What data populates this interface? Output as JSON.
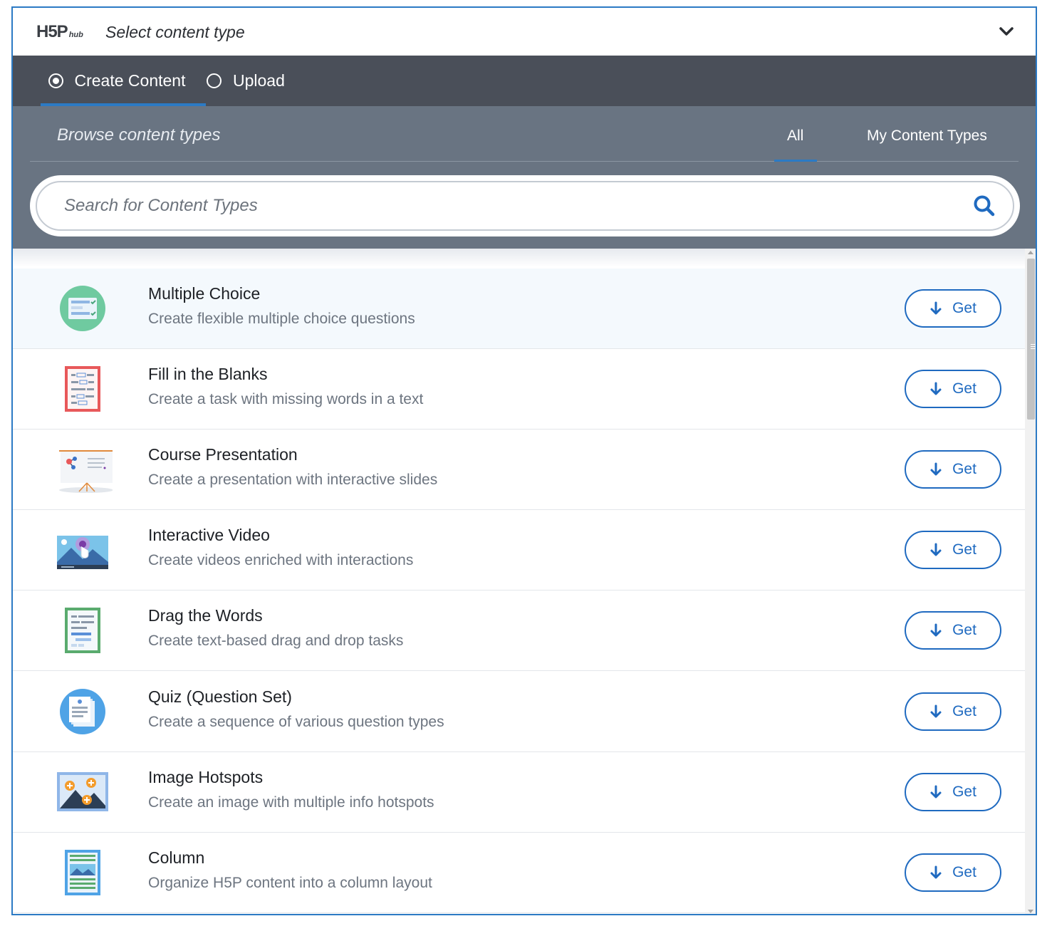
{
  "header": {
    "logo_main": "H5P",
    "logo_sub": "hub",
    "title": "Select content type"
  },
  "tabs": [
    {
      "label": "Create Content",
      "selected": true
    },
    {
      "label": "Upload",
      "selected": false
    }
  ],
  "browse": {
    "title": "Browse content types",
    "filters": [
      {
        "label": "All",
        "active": true
      },
      {
        "label": "My Content Types",
        "active": false
      }
    ]
  },
  "search": {
    "placeholder": "Search for Content Types",
    "value": ""
  },
  "items": [
    {
      "title": "Multiple Choice",
      "description": "Create flexible multiple choice questions",
      "icon": "multiple-choice-icon",
      "button": "Get"
    },
    {
      "title": "Fill in the Blanks",
      "description": "Create a task with missing words in a text",
      "icon": "fill-in-the-blanks-icon",
      "button": "Get"
    },
    {
      "title": "Course Presentation",
      "description": "Create a presentation with interactive slides",
      "icon": "course-presentation-icon",
      "button": "Get"
    },
    {
      "title": "Interactive Video",
      "description": "Create videos enriched with interactions",
      "icon": "interactive-video-icon",
      "button": "Get"
    },
    {
      "title": "Drag the Words",
      "description": "Create text-based drag and drop tasks",
      "icon": "drag-the-words-icon",
      "button": "Get"
    },
    {
      "title": "Quiz (Question Set)",
      "description": "Create a sequence of various question types",
      "icon": "quiz-question-set-icon",
      "button": "Get"
    },
    {
      "title": "Image Hotspots",
      "description": "Create an image with multiple info hotspots",
      "icon": "image-hotspots-icon",
      "button": "Get"
    },
    {
      "title": "Column",
      "description": "Organize H5P content into a column layout",
      "icon": "column-icon",
      "button": "Get"
    }
  ],
  "colors": {
    "accent": "#1f6ac0",
    "tabbar_bg": "#4a4f59",
    "browse_bg": "#697482",
    "frame_border": "#2c7ac4"
  }
}
